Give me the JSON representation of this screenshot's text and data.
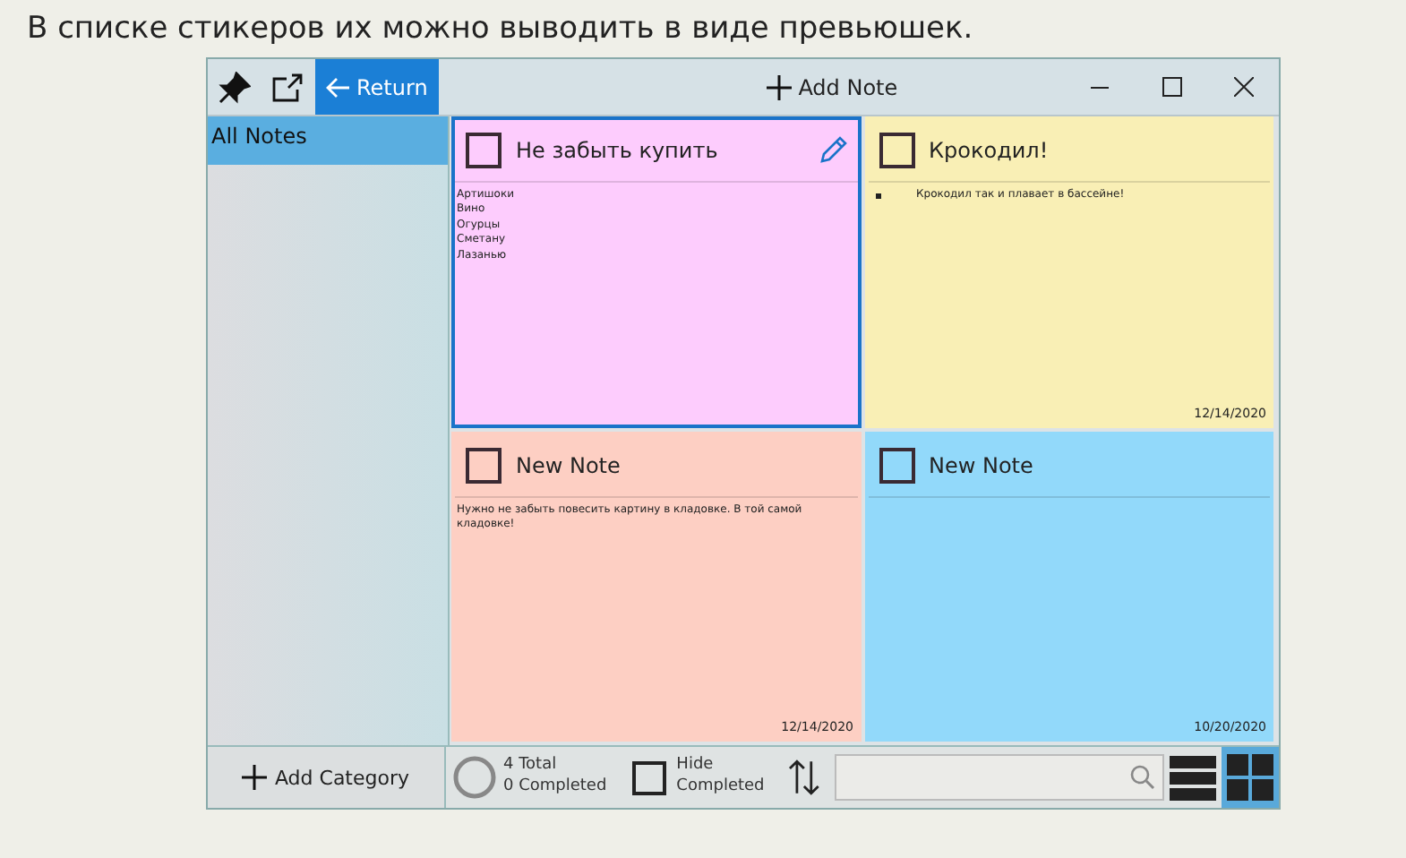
{
  "caption": "В списке стикеров их можно выводить в виде превьюшек.",
  "toolbar": {
    "return": "Return",
    "add_note": "Add Note"
  },
  "sidebar": {
    "items": [
      {
        "label": "All Notes",
        "selected": true
      }
    ],
    "add_category": "Add Category"
  },
  "notes": [
    {
      "title": "Не забыть купить",
      "checked": false,
      "selected": true,
      "color": "#fdccfd",
      "kind": "lines",
      "lines": [
        "Артишоки",
        "Вино",
        "Огурцы",
        "Сметану",
        "Лазанью"
      ]
    },
    {
      "title": "Крокодил!",
      "checked": false,
      "selected": false,
      "color": "#f9efb5",
      "kind": "bullets",
      "lines": [
        "Крокодил так и плавает в бассейне!"
      ],
      "date": "12/14/2020"
    },
    {
      "title": "New Note",
      "checked": false,
      "selected": false,
      "color": "#fdcfc3",
      "kind": "lines",
      "lines": [
        "Нужно не забыть повесить картину в кладовке. В той самой кладовке!"
      ],
      "date": "12/14/2020"
    },
    {
      "title": "New Note",
      "checked": false,
      "selected": false,
      "color": "#92d9fa",
      "date": "10/20/2020"
    }
  ],
  "status": {
    "total": "4 Total",
    "completed": "0 Completed",
    "hide_completed": "Hide Completed",
    "hide_checked": false
  },
  "view_modes": [
    {
      "kind": "list",
      "selected": false
    },
    {
      "kind": "grid",
      "selected": true
    }
  ]
}
